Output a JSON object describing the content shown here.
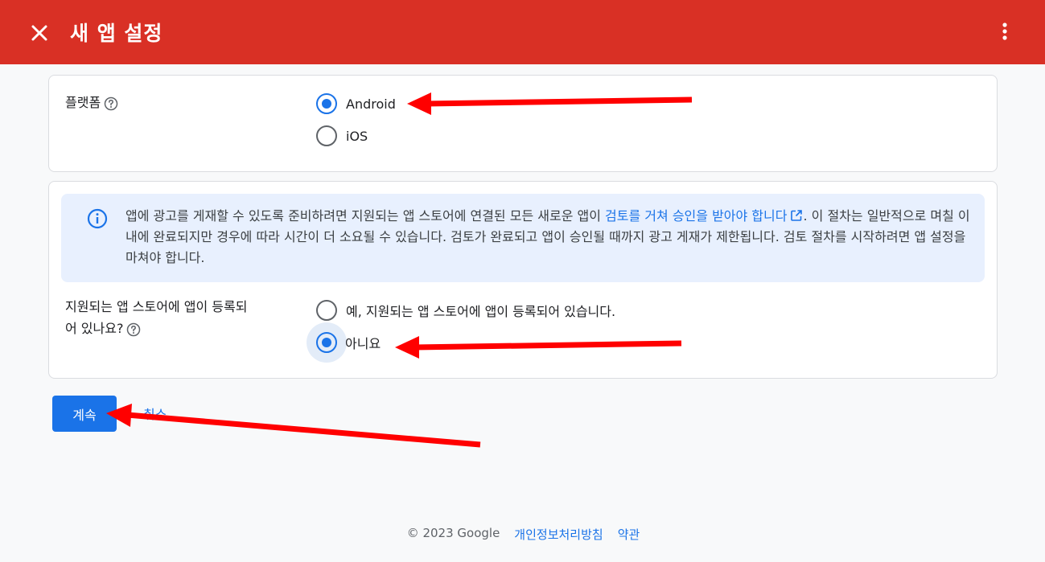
{
  "header": {
    "title": "새 앱 설정",
    "close_icon": "close-icon",
    "more_icon": "more-vert-icon",
    "color": "#d93025"
  },
  "platform": {
    "label": "플랫폼",
    "options": [
      {
        "label": "Android",
        "selected": true
      },
      {
        "label": "iOS",
        "selected": false
      }
    ]
  },
  "info": {
    "text_before": "앱에 광고를 게재할 수 있도록 준비하려면 지원되는 앱 스토어에 연결된 모든 새로운 앱이 ",
    "link": "검토를 거쳐 승인을 받아야 합니다",
    "text_after": ". 이 절차는 일반적으로 며칠 이내에 완료되지만 경우에 따라 시간이 더 소요될 수 있습니다. 검토가 완료되고 앱이 승인될 때까지 광고 게재가 제한됩니다. 검토 절차를 시작하려면 앱 설정을 마쳐야 합니다."
  },
  "store": {
    "label_line1": "지원되는 앱 스토어에 앱이 등록되",
    "label_line2": "어 있나요?",
    "options": [
      {
        "label": "예, 지원되는 앱 스토어에 앱이 등록되어 있습니다.",
        "selected": false
      },
      {
        "label": "아니요",
        "selected": true
      }
    ]
  },
  "actions": {
    "continue_label": "계속",
    "cancel_label": "취소"
  },
  "footer": {
    "copyright": "© 2023 Google",
    "privacy": "개인정보처리방침",
    "terms": "약관"
  },
  "colors": {
    "primary": "#1a73e8",
    "annotation_arrow": "#ff0000"
  }
}
